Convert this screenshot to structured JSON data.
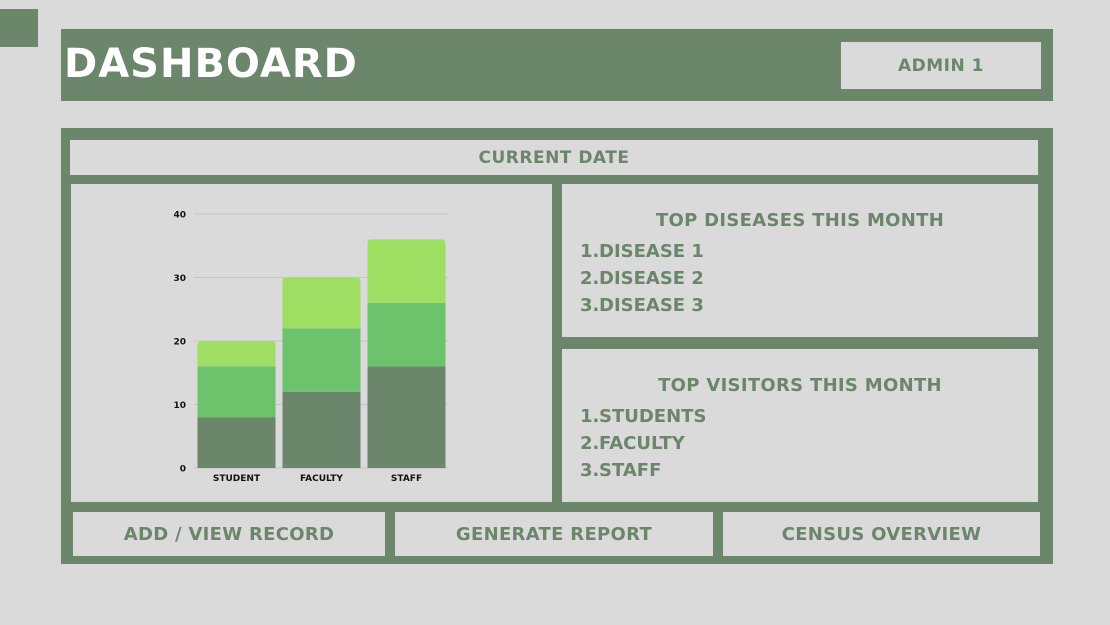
{
  "header": {
    "title": "DASHBOARD",
    "user": "ADMIN 1"
  },
  "date_bar": {
    "label": "CURRENT DATE"
  },
  "diseases": {
    "heading": "TOP DISEASES THIS MONTH",
    "items": [
      {
        "num": "1.",
        "label": "DISEASE 1"
      },
      {
        "num": "2.",
        "label": "DISEASE 2"
      },
      {
        "num": "3.",
        "label": "DISEASE 3"
      }
    ]
  },
  "visitors": {
    "heading": "TOP VISITORS THIS MONTH",
    "items": [
      {
        "num": "1.",
        "label": "STUDENTS"
      },
      {
        "num": "2.",
        "label": "FACULTY"
      },
      {
        "num": "3.",
        "label": "STAFF"
      }
    ]
  },
  "actions": {
    "add_view": "ADD / VIEW RECORD",
    "report": "GENERATE REPORT",
    "census": "CENSUS OVERVIEW"
  },
  "colors": {
    "brand": "#6b866b",
    "background": "#dadada",
    "segment_dark": "#6b866b",
    "segment_mid": "#6cc36c",
    "segment_light": "#9edf63"
  },
  "chart_data": {
    "type": "bar",
    "stacked": true,
    "categories": [
      "STUDENT",
      "FACULTY",
      "STAFF"
    ],
    "series": [
      {
        "values": [
          8,
          12,
          16
        ],
        "color": "#6b866b"
      },
      {
        "values": [
          8,
          10,
          10
        ],
        "color": "#6cc36c"
      },
      {
        "values": [
          4,
          8,
          10
        ],
        "color": "#9edf63"
      }
    ],
    "ylim": [
      0,
      40
    ],
    "yticks": [
      0,
      10,
      20,
      30,
      40
    ],
    "grid": true,
    "title": "",
    "xlabel": "",
    "ylabel": ""
  }
}
